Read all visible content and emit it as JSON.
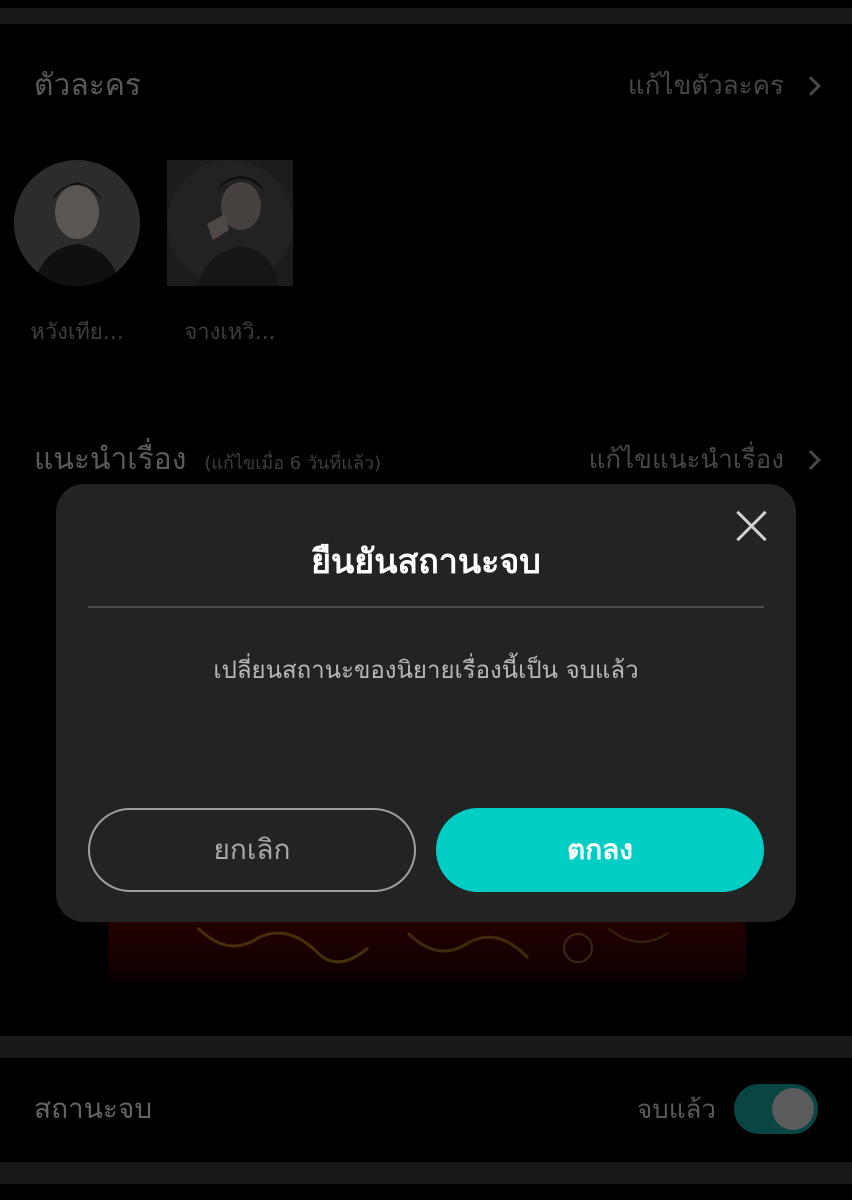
{
  "characters_section": {
    "title": "ตัวละคร",
    "edit_link": "แก้ไขตัวละคร",
    "items": [
      {
        "name": "หวังเทีย..."
      },
      {
        "name": "จางเหวิ..."
      }
    ]
  },
  "synopsis_section": {
    "title": "แนะนำเรื่อง",
    "subtitle": "(แก้ไขเมื่อ 6 วันที่แล้ว)",
    "edit_link": "แก้ไขแนะนำเรื่อง"
  },
  "finish_section": {
    "label": "สถานะจบ",
    "status": "จบแล้ว",
    "toggle_on": true
  },
  "modal": {
    "title": "ยืนยันสถานะจบ",
    "message": "เปลี่ยนสถานะของนิยายเรื่องนี้เป็น จบแล้ว",
    "cancel_label": "ยกเลิก",
    "ok_label": "ตกลง"
  },
  "colors": {
    "accent": "#00cdc4",
    "toggle_track": "#0f6b66",
    "modal_bg": "#232323",
    "page_bg": "#000000"
  }
}
